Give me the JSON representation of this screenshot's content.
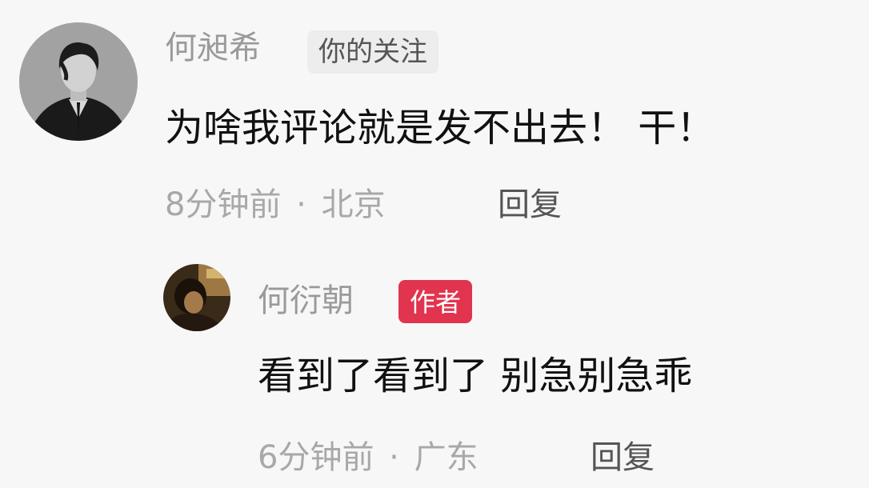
{
  "comments": [
    {
      "username": "何昶希",
      "badge": "你的关注",
      "text": "为啥我评论就是发不出去！ 干！",
      "time": "8分钟前",
      "separator": "·",
      "location": "北京",
      "reply_label": "回复",
      "avatar_icon": "user-avatar-monochrome-portrait"
    }
  ],
  "replies": [
    {
      "username": "何衍朝",
      "badge": "作者",
      "badge_color": "#e0344f",
      "text": "看到了看到了 别急别急乖",
      "time": "6分钟前",
      "separator": "·",
      "location": "广东",
      "reply_label": "回复",
      "avatar_icon": "author-avatar-sepia-portrait"
    }
  ]
}
